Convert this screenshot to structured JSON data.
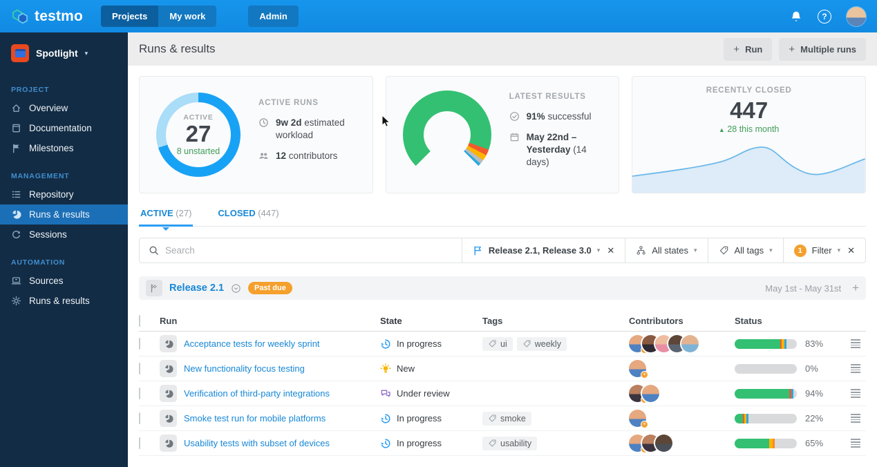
{
  "topnav": {
    "brand": "testmo",
    "tabs": [
      {
        "label": "Projects",
        "active": true
      },
      {
        "label": "My work",
        "active": false
      }
    ],
    "admin_label": "Admin"
  },
  "sidebar": {
    "project_name": "Spotlight",
    "sections": [
      {
        "title": "PROJECT",
        "items": [
          {
            "icon": "home",
            "label": "Overview"
          },
          {
            "icon": "book",
            "label": "Documentation"
          },
          {
            "icon": "flag",
            "label": "Milestones"
          }
        ]
      },
      {
        "title": "MANAGEMENT",
        "items": [
          {
            "icon": "list",
            "label": "Repository"
          },
          {
            "icon": "pie",
            "label": "Runs & results",
            "active": true
          },
          {
            "icon": "refresh",
            "label": "Sessions"
          }
        ]
      },
      {
        "title": "AUTOMATION",
        "items": [
          {
            "icon": "laptop",
            "label": "Sources"
          },
          {
            "icon": "gear",
            "label": "Runs & results"
          }
        ]
      }
    ]
  },
  "header": {
    "title": "Runs & results",
    "run_button": "Run",
    "multiple_runs_button": "Multiple runs"
  },
  "cards": {
    "active_runs": {
      "title": "ACTIVE RUNS",
      "center_label": "ACTIVE",
      "center_value": "27",
      "center_sub": "8 unstarted",
      "stats": [
        {
          "icon": "clock",
          "value": "9w 2d",
          "label": "estimated workload"
        },
        {
          "icon": "people",
          "value": "12",
          "label": "contributors"
        }
      ],
      "donut_segments": [
        {
          "label": "started",
          "color": "#18a2f5",
          "pct": 70
        },
        {
          "label": "unstarted",
          "color": "#a9ddf8",
          "pct": 30
        }
      ]
    },
    "latest_results": {
      "title": "LATEST RESULTS",
      "stats": [
        {
          "icon": "check",
          "value": "91%",
          "label": "successful"
        },
        {
          "icon": "calendar",
          "value": "May 22nd – Yesterday",
          "label": "(14 days)"
        }
      ],
      "gauge_stops": [
        {
          "color": "transparent",
          "from": 0,
          "to": 12.5
        },
        {
          "color": "#33c072",
          "from": 12.5,
          "to": 80.5
        },
        {
          "color": "#f05b2e",
          "from": 80.5,
          "to": 82.7
        },
        {
          "color": "#ffb400",
          "from": 82.7,
          "to": 84.8
        },
        {
          "color": "#b6bcc1",
          "from": 84.8,
          "to": 86.4
        },
        {
          "color": "#2aa9e0",
          "from": 86.4,
          "to": 87.5
        },
        {
          "color": "transparent",
          "from": 87.5,
          "to": 100
        }
      ]
    },
    "recently_closed": {
      "title": "RECENTLY CLOSED",
      "value": "447",
      "trend": "28 this month",
      "line_color": "#6cb9ea",
      "fill_color": "#ddecf8"
    }
  },
  "tabs": [
    {
      "label": "ACTIVE",
      "count": "(27)",
      "active": true
    },
    {
      "label": "CLOSED",
      "count": "(447)",
      "active": false
    }
  ],
  "filterbar": {
    "search_placeholder": "Search",
    "milestone_filter": "Release 2.1, Release 3.0",
    "states_filter": "All states",
    "tags_filter": "All tags",
    "filter_badge": "1",
    "filter_label": "Filter"
  },
  "group": {
    "title": "Release 2.1",
    "badge": "Past due",
    "date_range": "May 1st - May 31st"
  },
  "table": {
    "headers": {
      "run": "Run",
      "state": "State",
      "tags": "Tags",
      "contributors": "Contributors",
      "status": "Status"
    },
    "rows": [
      {
        "name": "Acceptance tests for weekly sprint",
        "state": {
          "icon": "history",
          "label": "In progress"
        },
        "tags": [
          "ui",
          "weekly"
        ],
        "contributors": [
          {
            "face": "#e5a87f",
            "body": "#4e81c2",
            "badge": true
          },
          {
            "face": "#8a5a40",
            "body": "#2f2a33"
          },
          {
            "face": "#eebda0",
            "body": "#e88ea4"
          },
          {
            "face": "#5d4637",
            "body": "#5a6470"
          },
          {
            "face": "#e3b391",
            "body": "#7fb3d6"
          }
        ],
        "pct": "83%",
        "bar": [
          {
            "color": "#33c072",
            "pct": 73
          },
          {
            "color": "#f05b2e",
            "pct": 3
          },
          {
            "color": "#ffb400",
            "pct": 3.5
          },
          {
            "color": "#2aa9e0",
            "pct": 3.5
          }
        ]
      },
      {
        "name": "New functionality focus testing",
        "state": {
          "icon": "bulb",
          "label": "New"
        },
        "tags": [],
        "contributors": [
          {
            "face": "#e5a87f",
            "body": "#4e81c2",
            "badge": true
          }
        ],
        "pct": "0%",
        "bar": []
      },
      {
        "name": "Verification of third-party integrations",
        "state": {
          "icon": "chat",
          "label": "Under review"
        },
        "tags": [],
        "contributors": [
          {
            "face": "#b97f5e",
            "body": "#3b3440",
            "badge": true
          },
          {
            "face": "#e5a87f",
            "body": "#4e81c2"
          }
        ],
        "pct": "94%",
        "bar": [
          {
            "color": "#33c072",
            "pct": 88
          },
          {
            "color": "#f05b2e",
            "pct": 3
          },
          {
            "color": "#2aa9e0",
            "pct": 3
          }
        ]
      },
      {
        "name": "Smoke test run for mobile platforms",
        "state": {
          "icon": "history",
          "label": "In progress"
        },
        "tags": [
          "smoke"
        ],
        "contributors": [
          {
            "face": "#e5a87f",
            "body": "#4e81c2",
            "badge": true
          }
        ],
        "pct": "22%",
        "bar": [
          {
            "color": "#33c072",
            "pct": 13
          },
          {
            "color": "#f05b2e",
            "pct": 3
          },
          {
            "color": "#ffb400",
            "pct": 3
          },
          {
            "color": "#2aa9e0",
            "pct": 3
          }
        ]
      },
      {
        "name": "Usability tests with subset of devices",
        "state": {
          "icon": "history",
          "label": "In progress"
        },
        "tags": [
          "usability"
        ],
        "contributors": [
          {
            "face": "#e5a87f",
            "body": "#4e81c2",
            "badge": true
          },
          {
            "face": "#b97f5e",
            "body": "#3b3440"
          },
          {
            "face": "#5d4637",
            "body": "#4b4f57"
          }
        ],
        "pct": "65%",
        "bar": [
          {
            "color": "#33c072",
            "pct": 56
          },
          {
            "color": "#ffb400",
            "pct": 5
          },
          {
            "color": "#fd8a25",
            "pct": 4
          }
        ]
      }
    ]
  }
}
